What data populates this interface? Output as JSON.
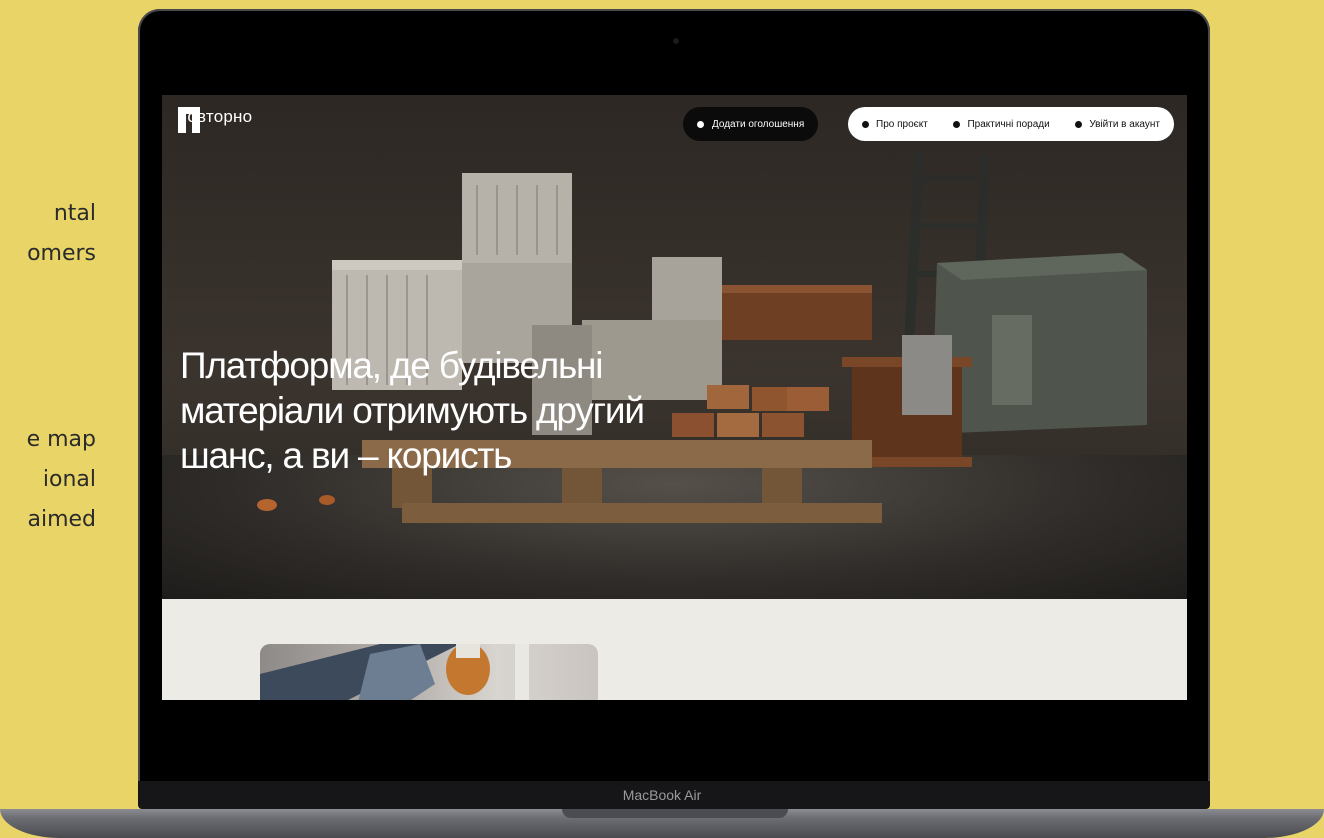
{
  "side_copy": {
    "block_a": [
      "ntal",
      "omers"
    ],
    "block_b": [
      "e map",
      "ional",
      "aimed"
    ]
  },
  "site": {
    "logo_text": "повторно",
    "add_listing_label": "Додати оголошення",
    "nav": [
      {
        "label": "Про проєкт"
      },
      {
        "label": "Практичні поради"
      },
      {
        "label": "Увійти в акаунт"
      }
    ],
    "hero_headline": [
      "Платформа, де будівельні",
      "матеріали отримують другий",
      "шанс, а ви – користь"
    ]
  },
  "device": {
    "label": "MacBook Air"
  },
  "colors": {
    "page_background": "#e8d467",
    "screen_section_background": "#ecebe6",
    "pill_dark": "#0b0b0b",
    "pill_light": "#ffffff"
  }
}
